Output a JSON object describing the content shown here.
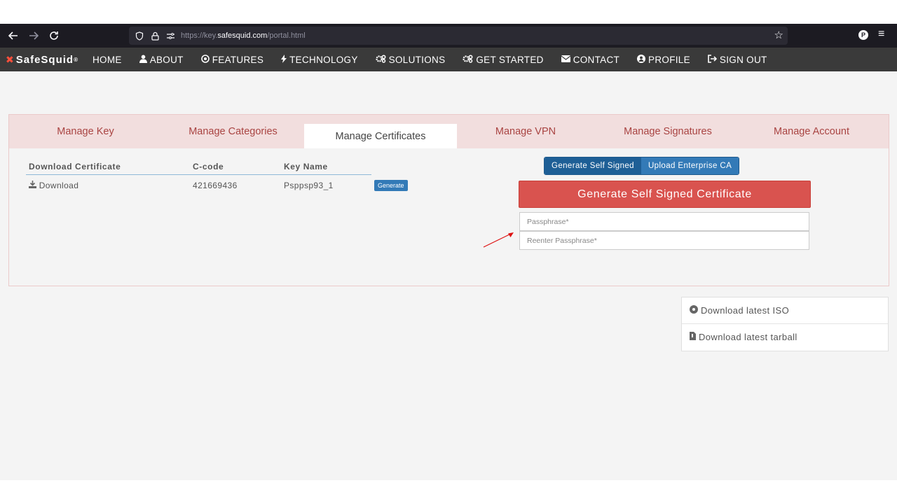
{
  "browser": {
    "url_prefix": "https://key.",
    "url_domain": "safesquid.com",
    "url_path": "/portal.html",
    "profile_initial": "P"
  },
  "site_nav": {
    "logo_text": "SafeSquid",
    "logo_mark": "®",
    "items": [
      {
        "label": "HOME",
        "icon": ""
      },
      {
        "label": "ABOUT",
        "icon": "user-icon"
      },
      {
        "label": "FEATURES",
        "icon": "target-icon"
      },
      {
        "label": "TECHNOLOGY",
        "icon": "bolt-icon"
      },
      {
        "label": "SOLUTIONS",
        "icon": "gears-icon"
      },
      {
        "label": "GET STARTED",
        "icon": "gears-icon"
      },
      {
        "label": "CONTACT",
        "icon": "envelope-icon"
      },
      {
        "label": "PROFILE",
        "icon": "user-circle-icon"
      },
      {
        "label": "SIGN OUT",
        "icon": "sign-out-icon"
      }
    ]
  },
  "tabs": [
    "Manage Key",
    "Manage Categories",
    "Manage Certificates",
    "Manage VPN",
    "Manage Signatures",
    "Manage Account"
  ],
  "active_tab": "Manage Certificates",
  "table": {
    "headers": [
      "Download Certificate",
      "C-code",
      "Key Name"
    ],
    "rows": [
      {
        "download": "Download",
        "ccode": "421669436",
        "key_name": "Psppsp93_1",
        "action": "Generate"
      }
    ]
  },
  "cert_actions": {
    "self_signed": "Generate Self Signed",
    "enterprise": "Upload Enterprise CA",
    "generate_button": "Generate Self Signed Certificate",
    "passphrase_placeholder": "Passphrase*",
    "reenter_placeholder": "Reenter Passphrase*"
  },
  "downloads": {
    "iso": "Download latest ISO",
    "tarball": "Download latest tarball"
  },
  "colors": {
    "tab_bg": "#f2dede",
    "tab_text": "#a94442",
    "danger": "#d9534f",
    "primary": "#337ab7",
    "nav_bg": "#3a3a3a"
  }
}
